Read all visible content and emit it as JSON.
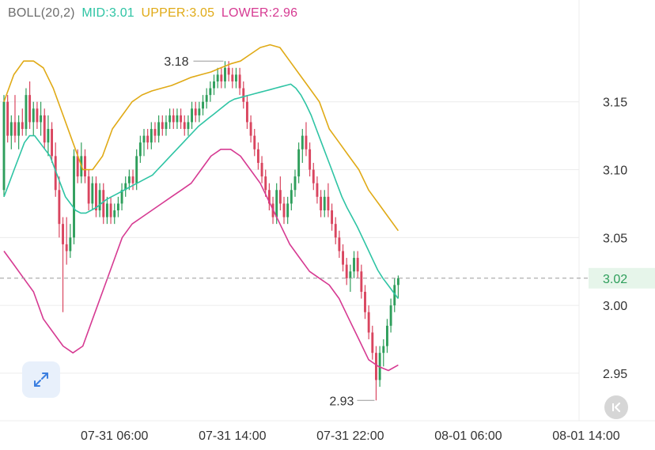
{
  "legend": {
    "indicator": "BOLL(20,2)",
    "mid": "MID:3.01",
    "upper": "UPPER:3.05",
    "lower": "LOWER:2.96"
  },
  "colors": {
    "up": "#2e9e5b",
    "down": "#d9455f",
    "mid": "#2ec4a4",
    "upper": "#e0aa16",
    "lower": "#d63a92",
    "price_line": "#9a9a9a",
    "price_badge_bg": "#e6f5ea",
    "price_badge_text": "#2e9e5b",
    "grid": "#ececec",
    "axis_text": "#333333"
  },
  "controls": {
    "expand_icon": "expand-arrows-icon",
    "reset_icon": "chevron-left-bar-icon"
  },
  "chart_data": {
    "type": "candlestick",
    "title": "",
    "indicator": "BOLL(20,2)",
    "ylim": [
      2.915,
      3.225
    ],
    "y_ticks": [
      3.15,
      3.1,
      3.05,
      3.0,
      2.95
    ],
    "y_tick_labels": [
      "3.15",
      "3.10",
      "3.05",
      "3.00",
      "2.95"
    ],
    "x_tick_labels": [
      "07-31 06:00",
      "07-31 14:00",
      "07-31 22:00",
      "08-01 06:00",
      "08-01 14:00"
    ],
    "x_tick_candle_index": [
      30,
      62,
      94,
      126,
      158
    ],
    "last_price": 3.02,
    "last_price_label": "3.02",
    "annotations": [
      {
        "label": "3.18",
        "value": 3.18,
        "type": "high"
      },
      {
        "label": "2.93",
        "value": 2.93,
        "type": "low"
      }
    ],
    "ohlc": [
      [
        3.085,
        3.155,
        3.08,
        3.15
      ],
      [
        3.15,
        3.155,
        3.12,
        3.125
      ],
      [
        3.125,
        3.14,
        3.115,
        3.135
      ],
      [
        3.135,
        3.155,
        3.12,
        3.125
      ],
      [
        3.125,
        3.14,
        3.115,
        3.135
      ],
      [
        3.135,
        3.145,
        3.125,
        3.13
      ],
      [
        3.13,
        3.16,
        3.125,
        3.155
      ],
      [
        3.155,
        3.165,
        3.13,
        3.135
      ],
      [
        3.135,
        3.15,
        3.125,
        3.145
      ],
      [
        3.145,
        3.15,
        3.13,
        3.135
      ],
      [
        3.135,
        3.15,
        3.125,
        3.14
      ],
      [
        3.14,
        3.145,
        3.115,
        3.12
      ],
      [
        3.12,
        3.14,
        3.11,
        3.13
      ],
      [
        3.13,
        3.135,
        3.105,
        3.11
      ],
      [
        3.11,
        3.12,
        3.08,
        3.085
      ],
      [
        3.085,
        3.095,
        3.05,
        3.06
      ],
      [
        3.06,
        3.065,
        2.995,
        3.045
      ],
      [
        3.045,
        3.065,
        3.03,
        3.04
      ],
      [
        3.04,
        3.06,
        3.035,
        3.05
      ],
      [
        3.05,
        3.115,
        3.045,
        3.11
      ],
      [
        3.11,
        3.115,
        3.09,
        3.095
      ],
      [
        3.095,
        3.12,
        3.09,
        3.11
      ],
      [
        3.11,
        3.115,
        3.09,
        3.095
      ],
      [
        3.095,
        3.1,
        3.07,
        3.075
      ],
      [
        3.075,
        3.095,
        3.07,
        3.09
      ],
      [
        3.09,
        3.095,
        3.065,
        3.07
      ],
      [
        3.07,
        3.09,
        3.065,
        3.085
      ],
      [
        3.085,
        3.09,
        3.06,
        3.065
      ],
      [
        3.065,
        3.08,
        3.06,
        3.075
      ],
      [
        3.075,
        3.08,
        3.06,
        3.065
      ],
      [
        3.065,
        3.075,
        3.06,
        3.07
      ],
      [
        3.07,
        3.08,
        3.065,
        3.075
      ],
      [
        3.075,
        3.09,
        3.07,
        3.085
      ],
      [
        3.085,
        3.095,
        3.08,
        3.09
      ],
      [
        3.09,
        3.1,
        3.085,
        3.095
      ],
      [
        3.095,
        3.1,
        3.085,
        3.09
      ],
      [
        3.09,
        3.115,
        3.085,
        3.11
      ],
      [
        3.11,
        3.125,
        3.105,
        3.12
      ],
      [
        3.12,
        3.13,
        3.11,
        3.125
      ],
      [
        3.125,
        3.13,
        3.115,
        3.12
      ],
      [
        3.12,
        3.135,
        3.115,
        3.13
      ],
      [
        3.13,
        3.135,
        3.12,
        3.125
      ],
      [
        3.125,
        3.14,
        3.12,
        3.135
      ],
      [
        3.135,
        3.14,
        3.125,
        3.13
      ],
      [
        3.13,
        3.14,
        3.125,
        3.135
      ],
      [
        3.135,
        3.145,
        3.13,
        3.14
      ],
      [
        3.14,
        3.145,
        3.13,
        3.135
      ],
      [
        3.135,
        3.145,
        3.13,
        3.14
      ],
      [
        3.14,
        3.145,
        3.13,
        3.135
      ],
      [
        3.135,
        3.14,
        3.125,
        3.13
      ],
      [
        3.13,
        3.14,
        3.125,
        3.135
      ],
      [
        3.135,
        3.15,
        3.13,
        3.145
      ],
      [
        3.145,
        3.15,
        3.135,
        3.14
      ],
      [
        3.14,
        3.15,
        3.135,
        3.145
      ],
      [
        3.145,
        3.155,
        3.14,
        3.15
      ],
      [
        3.15,
        3.16,
        3.145,
        3.155
      ],
      [
        3.155,
        3.165,
        3.15,
        3.16
      ],
      [
        3.16,
        3.17,
        3.155,
        3.165
      ],
      [
        3.165,
        3.175,
        3.16,
        3.17
      ],
      [
        3.17,
        3.175,
        3.16,
        3.165
      ],
      [
        3.165,
        3.18,
        3.16,
        3.175
      ],
      [
        3.175,
        3.18,
        3.165,
        3.17
      ],
      [
        3.17,
        3.175,
        3.16,
        3.165
      ],
      [
        3.165,
        3.175,
        3.16,
        3.17
      ],
      [
        3.17,
        3.175,
        3.155,
        3.16
      ],
      [
        3.16,
        3.165,
        3.145,
        3.15
      ],
      [
        3.15,
        3.155,
        3.13,
        3.135
      ],
      [
        3.135,
        3.14,
        3.12,
        3.125
      ],
      [
        3.125,
        3.13,
        3.11,
        3.115
      ],
      [
        3.115,
        3.12,
        3.1,
        3.105
      ],
      [
        3.105,
        3.11,
        3.09,
        3.095
      ],
      [
        3.095,
        3.1,
        3.08,
        3.085
      ],
      [
        3.085,
        3.09,
        3.07,
        3.075
      ],
      [
        3.075,
        3.08,
        3.06,
        3.065
      ],
      [
        3.065,
        3.09,
        3.06,
        3.085
      ],
      [
        3.085,
        3.095,
        3.07,
        3.075
      ],
      [
        3.075,
        3.08,
        3.06,
        3.065
      ],
      [
        3.065,
        3.08,
        3.06,
        3.075
      ],
      [
        3.075,
        3.09,
        3.07,
        3.085
      ],
      [
        3.085,
        3.1,
        3.08,
        3.095
      ],
      [
        3.095,
        3.12,
        3.09,
        3.115
      ],
      [
        3.115,
        3.13,
        3.105,
        3.125
      ],
      [
        3.125,
        3.135,
        3.11,
        3.115
      ],
      [
        3.115,
        3.12,
        3.095,
        3.1
      ],
      [
        3.1,
        3.105,
        3.085,
        3.09
      ],
      [
        3.09,
        3.095,
        3.075,
        3.08
      ],
      [
        3.08,
        3.085,
        3.065,
        3.07
      ],
      [
        3.07,
        3.085,
        3.065,
        3.08
      ],
      [
        3.08,
        3.09,
        3.065,
        3.07
      ],
      [
        3.07,
        3.075,
        3.055,
        3.06
      ],
      [
        3.06,
        3.065,
        3.045,
        3.05
      ],
      [
        3.05,
        3.055,
        3.035,
        3.04
      ],
      [
        3.04,
        3.045,
        3.025,
        3.03
      ],
      [
        3.03,
        3.035,
        3.015,
        3.02
      ],
      [
        3.02,
        3.03,
        3.01,
        3.025
      ],
      [
        3.025,
        3.04,
        3.02,
        3.035
      ],
      [
        3.035,
        3.04,
        3.02,
        3.025
      ],
      [
        3.025,
        3.03,
        3.005,
        3.01
      ],
      [
        3.01,
        3.015,
        2.99,
        2.995
      ],
      [
        2.995,
        3.0,
        2.975,
        2.98
      ],
      [
        2.98,
        2.985,
        2.96,
        2.965
      ],
      [
        2.965,
        2.97,
        2.93,
        2.945
      ],
      [
        2.945,
        2.97,
        2.94,
        2.965
      ],
      [
        2.965,
        2.975,
        2.955,
        2.97
      ],
      [
        2.97,
        2.99,
        2.965,
        2.985
      ],
      [
        2.985,
        3.005,
        2.98,
        3.0
      ],
      [
        3.0,
        3.02,
        2.995,
        3.015
      ],
      [
        3.015,
        3.022,
        3.005,
        3.02
      ]
    ],
    "series": [
      {
        "name": "MID",
        "values": [
          3.08,
          3.09,
          3.1,
          3.11,
          3.12,
          3.125,
          3.125,
          3.12,
          3.115,
          3.11,
          3.1,
          3.09,
          3.08,
          3.075,
          3.07,
          3.068,
          3.068,
          3.07,
          3.072,
          3.075,
          3.078,
          3.08,
          3.082,
          3.084,
          3.086,
          3.088,
          3.09,
          3.092,
          3.094,
          3.096,
          3.1,
          3.104,
          3.108,
          3.112,
          3.116,
          3.12,
          3.124,
          3.128,
          3.132,
          3.135,
          3.138,
          3.141,
          3.144,
          3.147,
          3.15,
          3.152,
          3.153,
          3.154,
          3.155,
          3.156,
          3.157,
          3.158,
          3.159,
          3.16,
          3.161,
          3.162,
          3.163,
          3.16,
          3.155,
          3.148,
          3.14,
          3.13,
          3.12,
          3.11,
          3.1,
          3.09,
          3.08,
          3.072,
          3.065,
          3.058,
          3.05,
          3.042,
          3.034,
          3.026,
          3.02,
          3.015,
          3.01,
          3.005
        ]
      },
      {
        "name": "UPPER",
        "values": [
          3.15,
          3.17,
          3.18,
          3.18,
          3.175,
          3.16,
          3.14,
          3.12,
          3.1,
          3.1,
          3.11,
          3.13,
          3.14,
          3.15,
          3.155,
          3.158,
          3.16,
          3.162,
          3.165,
          3.168,
          3.17,
          3.172,
          3.175,
          3.178,
          3.18,
          3.185,
          3.19,
          3.192,
          3.19,
          3.18,
          3.17,
          3.16,
          3.15,
          3.13,
          3.12,
          3.11,
          3.1,
          3.085,
          3.075,
          3.065,
          3.055
        ]
      },
      {
        "name": "LOWER",
        "values": [
          3.04,
          3.03,
          3.02,
          3.01,
          2.99,
          2.98,
          2.97,
          2.965,
          2.97,
          2.99,
          3.01,
          3.03,
          3.05,
          3.06,
          3.065,
          3.07,
          3.075,
          3.08,
          3.085,
          3.09,
          3.1,
          3.11,
          3.115,
          3.115,
          3.11,
          3.1,
          3.09,
          3.075,
          3.06,
          3.045,
          3.035,
          3.025,
          3.02,
          3.015,
          3.005,
          2.99,
          2.975,
          2.96,
          2.955,
          2.952,
          2.956
        ]
      }
    ]
  }
}
